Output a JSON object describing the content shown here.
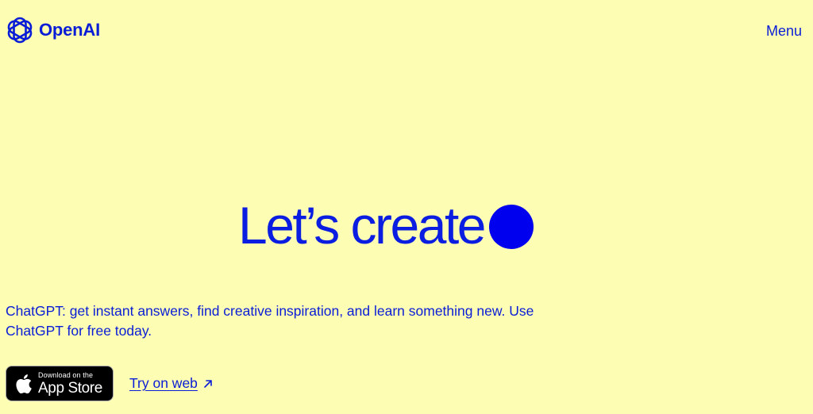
{
  "header": {
    "brand": "OpenAI",
    "menu_label": "Menu"
  },
  "hero": {
    "title": "Let’s create"
  },
  "description": "ChatGPT: get instant answers, find creative inspiration, and learn something new. Use ChatGPT for free today.",
  "cta": {
    "app_store_small": "Download on the",
    "app_store_big": "App Store",
    "try_web_label": "Try on web"
  },
  "icons": {
    "logo": "openai-logo-icon",
    "apple": "apple-icon",
    "arrow": "arrow-up-right-icon"
  },
  "colors": {
    "background": "#fdfdb4",
    "accent": "#0000ee",
    "badge": "#000000"
  }
}
